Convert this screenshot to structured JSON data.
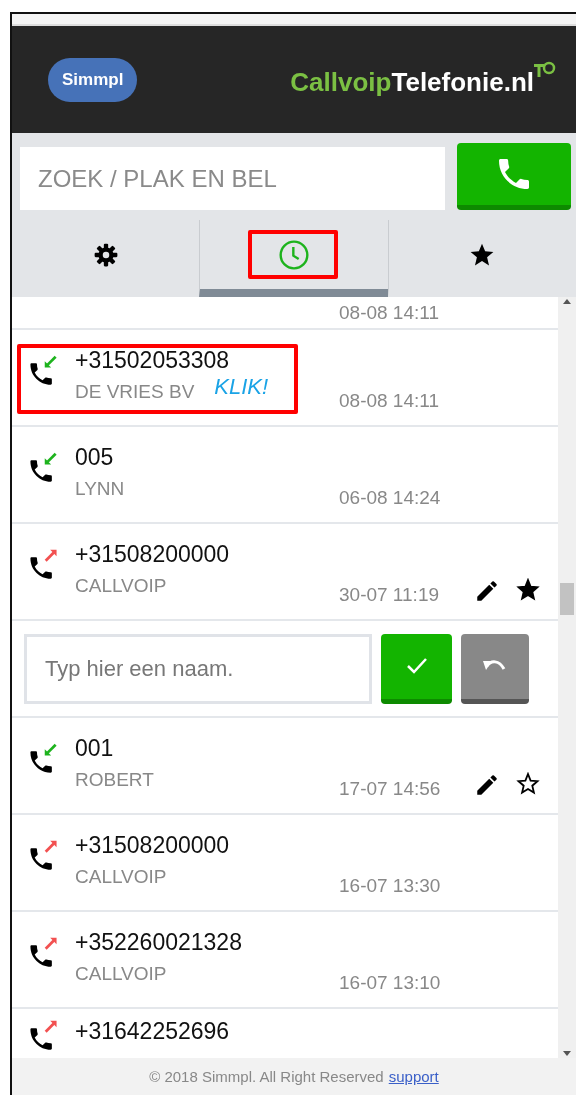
{
  "header": {
    "logo": "Simmpl",
    "brand": {
      "part_1": "Callvoip",
      "part_2": "Telefonie.nl"
    }
  },
  "search": {
    "placeholder": "ZOEK / PLAK EN BEL"
  },
  "tabs": [
    {
      "kind": "settings",
      "selected": false,
      "highlighted": false
    },
    {
      "kind": "history",
      "selected": true,
      "highlighted": true
    },
    {
      "kind": "favorites",
      "selected": false,
      "highlighted": false
    }
  ],
  "calls": [
    {
      "kind": "call",
      "time": "08-08 14:11",
      "highlighted": false,
      "actions": false
    },
    {
      "kind": "call",
      "outgoing": false,
      "number": "+31502053308",
      "name": "DE VRIES BV",
      "time": "08-08 14:11",
      "highlighted": true,
      "note": "KLIK!",
      "actions": false
    },
    {
      "kind": "call",
      "outgoing": false,
      "number": "005",
      "name": "LYNN",
      "time": "06-08 14:24",
      "highlighted": false,
      "actions": false
    },
    {
      "kind": "call",
      "outgoing": true,
      "number": "+31508200000",
      "name": "CALLVOIP",
      "time": "30-07 11:19",
      "highlighted": false,
      "actions": true,
      "starred": true
    },
    {
      "kind": "name_edit",
      "placeholder": "Typ hier een naam."
    },
    {
      "kind": "call",
      "outgoing": false,
      "number": "001",
      "name": "ROBERT",
      "time": "17-07 14:56",
      "highlighted": false,
      "actions": true,
      "starred": false
    },
    {
      "kind": "call",
      "outgoing": true,
      "number": "+31508200000",
      "name": "CALLVOIP",
      "time": "16-07 13:30",
      "highlighted": false,
      "actions": false
    },
    {
      "kind": "call",
      "outgoing": true,
      "number": "+352260021328",
      "name": "CALLVOIP",
      "time": "16-07 13:10",
      "highlighted": false,
      "actions": false
    },
    {
      "kind": "call",
      "outgoing": true,
      "number": "+31642252696",
      "highlighted": false,
      "actions": false
    }
  ],
  "footer": {
    "text": "© 2018 Simmpl. All Right Reserved",
    "link": "support"
  }
}
